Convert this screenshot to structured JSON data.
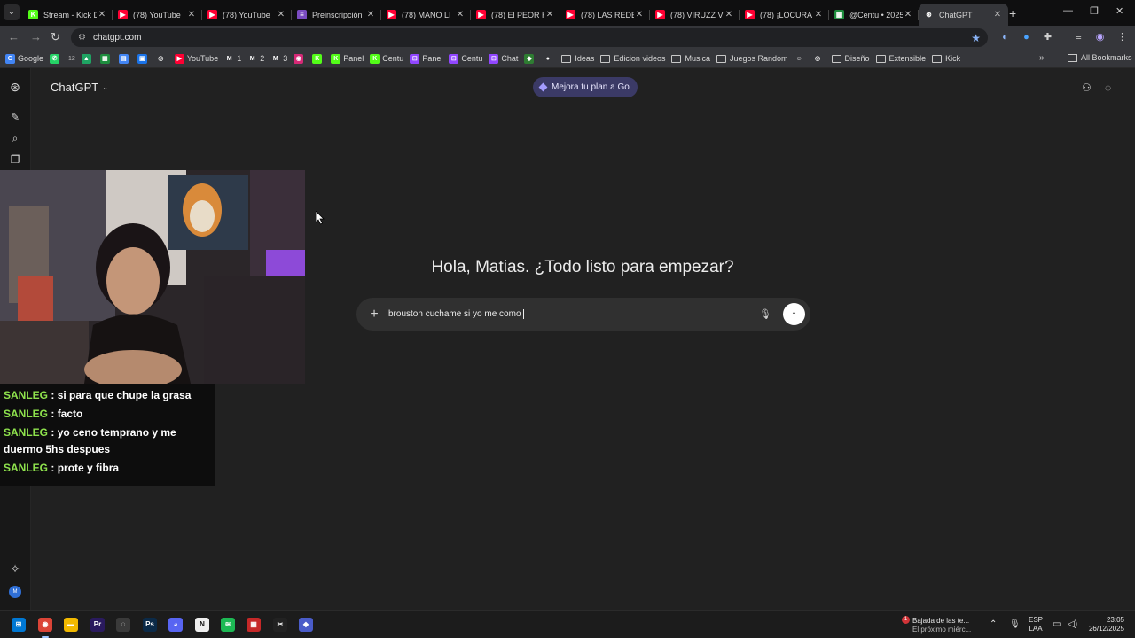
{
  "browser": {
    "tabs": [
      {
        "title": "Stream - Kick D",
        "favicon": "kick-icon",
        "color": "#53fc18",
        "glyph": "K"
      },
      {
        "title": "(78) YouTube",
        "favicon": "youtube-icon",
        "color": "#ff0033",
        "glyph": "▶"
      },
      {
        "title": "(78) YouTube",
        "favicon": "youtube-icon",
        "color": "#ff0033",
        "glyph": "▶"
      },
      {
        "title": "Preinscripción",
        "favicon": "form-icon",
        "color": "#7b4cc2",
        "glyph": "≡"
      },
      {
        "title": "(78) MANO LI",
        "favicon": "youtube-icon",
        "color": "#ff0033",
        "glyph": "▶"
      },
      {
        "title": "(78) El PEOR H",
        "favicon": "youtube-icon",
        "color": "#ff0033",
        "glyph": "▶"
      },
      {
        "title": "(78) LAS REDE",
        "favicon": "youtube-icon",
        "color": "#ff0033",
        "glyph": "▶"
      },
      {
        "title": "(78) VIRUZZ VI",
        "favicon": "youtube-icon",
        "color": "#ff0033",
        "glyph": "▶"
      },
      {
        "title": "(78) ¡LOCURA",
        "favicon": "youtube-icon",
        "color": "#ff0033",
        "glyph": "▶"
      },
      {
        "title": "@Centu • 2025",
        "favicon": "sheets-icon",
        "color": "#1e8e3e",
        "glyph": "▦"
      },
      {
        "title": "ChatGPT",
        "favicon": "chatgpt-icon",
        "color": "#35363a",
        "glyph": "⊛",
        "active": true
      }
    ],
    "url": "chatgpt.com",
    "bookmarks": [
      {
        "label": "Google",
        "icon": "google-icon",
        "color": "#4285f4",
        "glyph": "G"
      },
      {
        "label": "",
        "icon": "whatsapp-icon",
        "color": "#25d366",
        "glyph": "✆"
      },
      {
        "label": "12",
        "icon": "badge-count",
        "color": "#35363a",
        "glyph": ""
      },
      {
        "label": "",
        "icon": "drive-icon",
        "color": "#1fa463",
        "glyph": "▲"
      },
      {
        "label": "",
        "icon": "sheets-icon",
        "color": "#1e8e3e",
        "glyph": "▦"
      },
      {
        "label": "",
        "icon": "docs-icon",
        "color": "#4285f4",
        "glyph": "▤"
      },
      {
        "label": "",
        "icon": "calendar-icon",
        "color": "#1a73e8",
        "glyph": "▣"
      },
      {
        "label": "",
        "icon": "globe-icon",
        "color": "#35363a",
        "glyph": "◎"
      },
      {
        "label": "YouTube",
        "icon": "youtube-icon",
        "color": "#ff0033",
        "glyph": "▶"
      },
      {
        "label": "1",
        "icon": "gmail-icon",
        "color": "#35363a",
        "glyph": "M"
      },
      {
        "label": "2",
        "icon": "gmail-icon",
        "color": "#35363a",
        "glyph": "M"
      },
      {
        "label": "3",
        "icon": "gmail-icon",
        "color": "#35363a",
        "glyph": "M"
      },
      {
        "label": "",
        "icon": "instagram-icon",
        "color": "#d62976",
        "glyph": "◉"
      },
      {
        "label": "",
        "icon": "kick-icon",
        "color": "#53fc18",
        "glyph": "K"
      },
      {
        "label": "Panel",
        "icon": "kick-icon",
        "color": "#53fc18",
        "glyph": "K"
      },
      {
        "label": "Centu",
        "icon": "kick-icon",
        "color": "#53fc18",
        "glyph": "K"
      },
      {
        "label": "Panel",
        "icon": "twitch-icon",
        "color": "#9146ff",
        "glyph": "⊡"
      },
      {
        "label": "Centu",
        "icon": "twitch-icon",
        "color": "#9146ff",
        "glyph": "⊡"
      },
      {
        "label": "Chat",
        "icon": "twitch-icon",
        "color": "#9146ff",
        "glyph": "⊡"
      },
      {
        "label": "",
        "icon": "app-icon",
        "color": "#2e7d32",
        "glyph": "◆"
      },
      {
        "label": "",
        "icon": "github-icon",
        "color": "#35363a",
        "glyph": "●"
      },
      {
        "label": "Ideas",
        "icon": "folder-icon",
        "color": "",
        "glyph": ""
      },
      {
        "label": "Edicion videos",
        "icon": "folder-icon",
        "color": "",
        "glyph": ""
      },
      {
        "label": "Musica",
        "icon": "folder-icon",
        "color": "",
        "glyph": ""
      },
      {
        "label": "Juegos Random",
        "icon": "folder-icon",
        "color": "",
        "glyph": ""
      },
      {
        "label": "",
        "icon": "mascot-icon",
        "color": "#35363a",
        "glyph": "☺"
      },
      {
        "label": "",
        "icon": "globe-icon",
        "color": "#35363a",
        "glyph": "◎"
      },
      {
        "label": "Diseño",
        "icon": "folder-icon",
        "color": "",
        "glyph": ""
      },
      {
        "label": "Extensible",
        "icon": "folder-icon",
        "color": "",
        "glyph": ""
      },
      {
        "label": "Kick",
        "icon": "folder-icon",
        "color": "",
        "glyph": ""
      }
    ],
    "all_bookmarks": "All Bookmarks"
  },
  "app": {
    "model": "ChatGPT",
    "upgrade": "Mejora tu plan a Go",
    "greeting": "Hola, Matias. ¿Todo listo para empezar?",
    "composer_text": "brouston cuchame si yo me como",
    "avatar_initials": "M"
  },
  "stream_chat": [
    {
      "user": "SANLEG",
      "message": "si para que chupe la grasa"
    },
    {
      "user": "SANLEG",
      "message": "facto"
    },
    {
      "user": "SANLEG",
      "message": "yo ceno temprano y me duermo 5hs despues"
    },
    {
      "user": "SANLEG",
      "message": "prote y fibra"
    }
  ],
  "taskbar": {
    "apps": [
      {
        "name": "start-icon",
        "color": "#0078d4",
        "glyph": "⊞"
      },
      {
        "name": "chrome-icon",
        "color": "#db4437",
        "glyph": "◉",
        "active": true
      },
      {
        "name": "file-explorer-icon",
        "color": "#f2b900",
        "glyph": "▬"
      },
      {
        "name": "premiere-icon",
        "color": "#2a1a5e",
        "glyph": "Pr"
      },
      {
        "name": "photoshop-icon",
        "color": "#0b2a48",
        "glyph": "Ps"
      },
      {
        "name": "obs-icon",
        "color": "#3a3a3a",
        "glyph": "◌"
      },
      {
        "name": "discord-icon",
        "color": "#5865f2",
        "glyph": "◕"
      },
      {
        "name": "notion-icon",
        "color": "#eeeeee",
        "glyph": "N"
      },
      {
        "name": "spotify-icon",
        "color": "#1db954",
        "glyph": "≋"
      },
      {
        "name": "streamdeck-icon",
        "color": "#c62828",
        "glyph": "▦"
      },
      {
        "name": "capcut-icon",
        "color": "#222222",
        "glyph": "✂"
      },
      {
        "name": "app-icon",
        "color": "#4a5cc9",
        "glyph": "◆"
      }
    ],
    "news_title": "Bajada de las te...",
    "news_sub": "El próximo miérc...",
    "news_badge": "1",
    "lang_top": "ESP",
    "lang_bottom": "LAA",
    "time": "23:05",
    "date": "26/12/2025"
  }
}
